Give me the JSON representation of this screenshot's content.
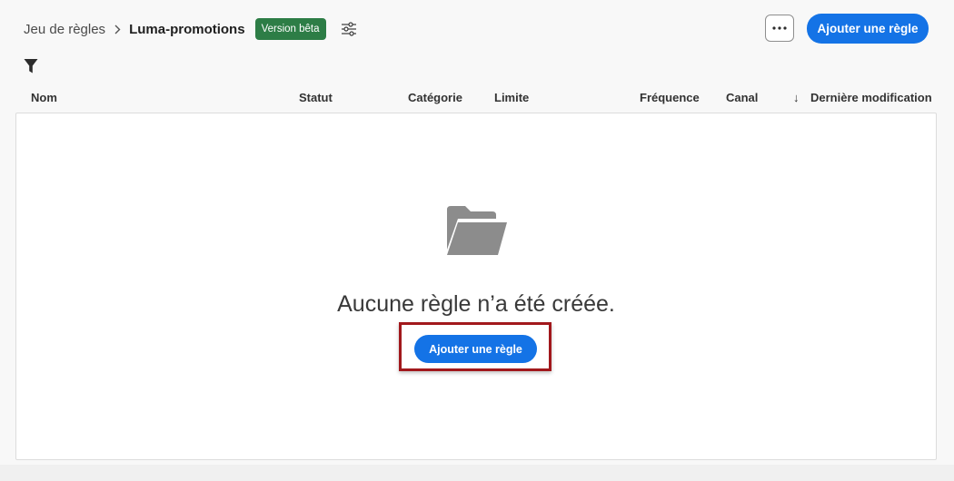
{
  "breadcrumb": {
    "parent": "Jeu de règles",
    "current": "Luma-promotions",
    "badge": "Version bêta"
  },
  "toolbar": {
    "more_label": "···",
    "add_rule_label": "Ajouter une règle"
  },
  "table": {
    "columns": [
      "Nom",
      "Statut",
      "Catégorie",
      "Limite",
      "Fréquence",
      "Canal",
      "Dernière modification"
    ],
    "sort_indicator": "↓",
    "sorted_column": "Dernière modification"
  },
  "empty_state": {
    "icon": "folder-icon",
    "message": "Aucune règle n’a été créée.",
    "add_rule_label": "Ajouter une règle"
  },
  "colors": {
    "accent": "#1473e6",
    "badge": "#2d7d46",
    "highlight": "#a1181c"
  }
}
